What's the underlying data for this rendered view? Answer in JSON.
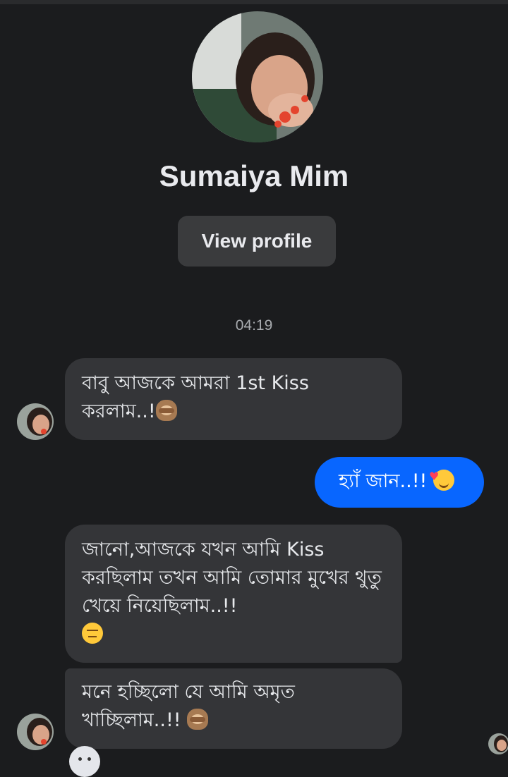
{
  "header": {
    "contact_name": "Sumaiya Mim",
    "view_profile_label": "View profile"
  },
  "conversation": {
    "timestamp": "04:19",
    "messages": [
      {
        "direction": "incoming",
        "text": "বাবু আজকে আমরা 1st Kiss করলাম..!",
        "emoji": "see-no-evil-monkey-icon"
      },
      {
        "direction": "outgoing",
        "text": "হ্যাঁ জান..!!",
        "emoji": "smiling-face-with-hearts-icon"
      },
      {
        "direction": "incoming",
        "text": "জানো,আজকে যখন আমি Kiss করছিলাম  তখন আমি তোমার মুখের থুতু খেয়ে নিয়েছিলাম..!!",
        "emoji": "weary-face-icon"
      },
      {
        "direction": "incoming",
        "text": "মনে হচ্ছিলো যে আমি অমৃত খাচ্ছিলাম..!!",
        "emoji": "see-no-evil-monkey-icon"
      }
    ]
  },
  "colors": {
    "background": "#1b1c1e",
    "incoming_bubble": "#343538",
    "outgoing_bubble": "#0866ff"
  }
}
